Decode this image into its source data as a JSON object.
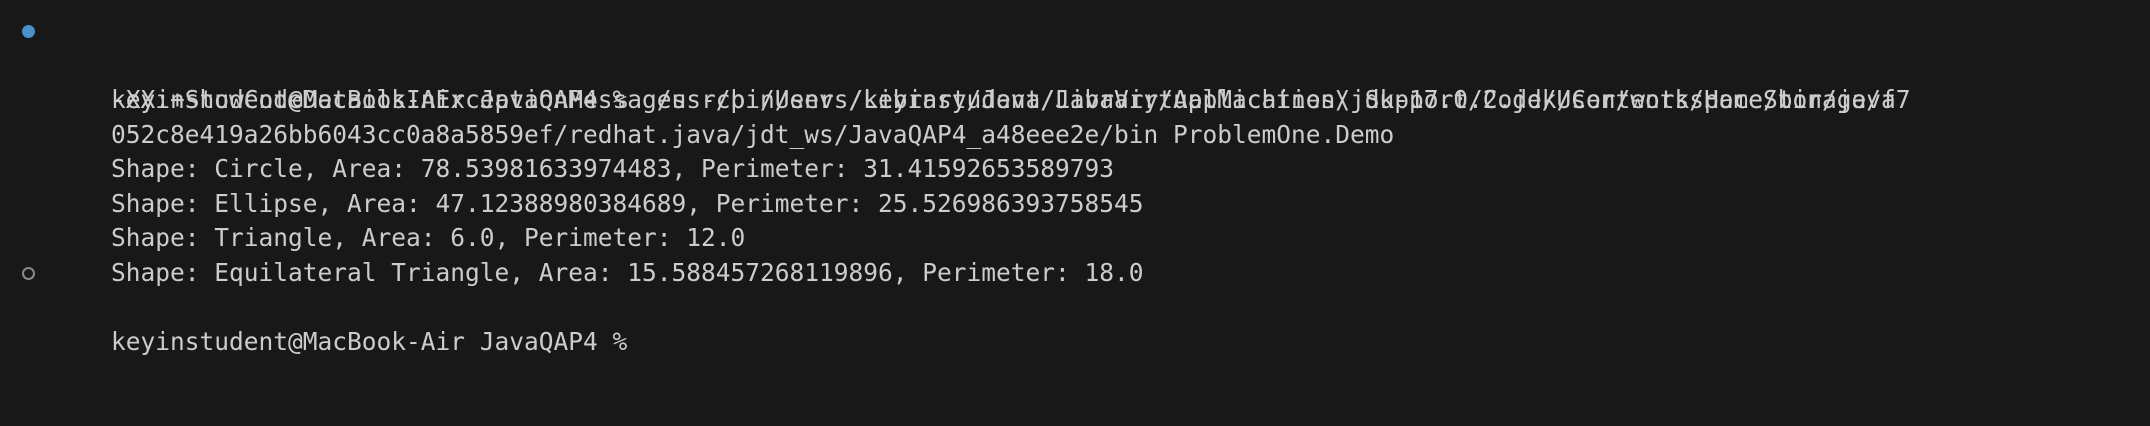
{
  "terminal": {
    "prompt_line_1": "keyinstudent@MacBook-Air JavaQAP4 %  /usr/bin/env /Library/Java/JavaVirtualMachines/jdk-17.0.2.jdk/Contents/Home/bin/java",
    "command_wrap_1": "-XX:+ShowCodeDetailsInExceptionMessages -cp /Users/keyinstudent/Library/Application\\ Support/Code/User/workspaceStorage/f7",
    "command_wrap_2": "052c8e419a26bb6043cc0a8a5859ef/redhat.java/jdt_ws/JavaQAP4_a48eee2e/bin ProblemOne.Demo",
    "output": [
      "Shape: Circle, Area: 78.53981633974483, Perimeter: 31.41592653589793",
      "Shape: Ellipse, Area: 47.12388980384689, Perimeter: 25.526986393758545",
      "Shape: Triangle, Area: 6.0, Perimeter: 12.0",
      "Shape: Equilateral Triangle, Area: 15.588457268119896, Perimeter: 18.0"
    ],
    "prompt_line_2": "keyinstudent@MacBook-Air JavaQAP4 % "
  },
  "colors": {
    "background": "#181818",
    "text": "#cccccc",
    "marker_success": "#4a90c9",
    "marker_idle": "#8a8a8a"
  },
  "icons": {
    "completed_command_marker": "filled-circle-icon",
    "current_prompt_marker": "hollow-circle-icon"
  }
}
